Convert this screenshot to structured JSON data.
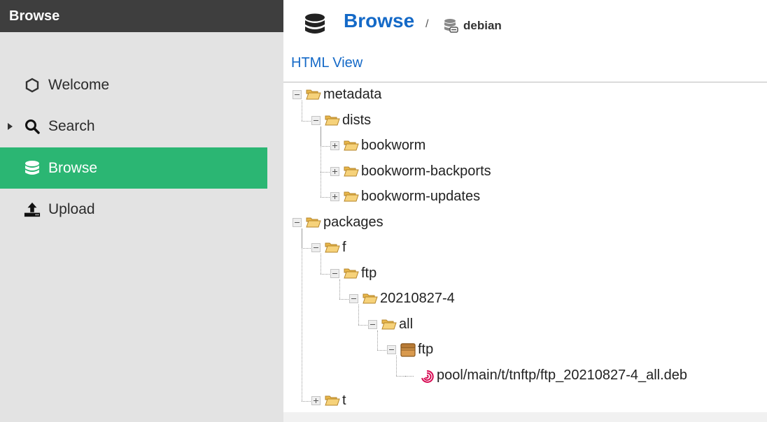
{
  "sidebar": {
    "title": "Browse",
    "items": [
      {
        "label": "Welcome",
        "icon": "hexagon-icon"
      },
      {
        "label": "Search",
        "icon": "search-icon"
      },
      {
        "label": "Browse",
        "icon": "database-icon",
        "active": true
      },
      {
        "label": "Upload",
        "icon": "upload-icon"
      }
    ]
  },
  "header": {
    "title": "Browse",
    "separator": "/",
    "repository": "debian"
  },
  "html_view_link": "HTML View",
  "tree": [
    {
      "label": "metadata",
      "icon": "folder-open-icon",
      "state": "expanded",
      "depth": 0
    },
    {
      "label": "dists",
      "icon": "folder-open-icon",
      "state": "expanded",
      "depth": 1
    },
    {
      "label": "bookworm",
      "icon": "folder-open-icon",
      "state": "collapsed",
      "depth": 2
    },
    {
      "label": "bookworm-backports",
      "icon": "folder-open-icon",
      "state": "collapsed",
      "depth": 2
    },
    {
      "label": "bookworm-updates",
      "icon": "folder-open-icon",
      "state": "collapsed",
      "depth": 2
    },
    {
      "label": "packages",
      "icon": "folder-open-icon",
      "state": "expanded",
      "depth": 0
    },
    {
      "label": "f",
      "icon": "folder-open-icon",
      "state": "expanded",
      "depth": 1
    },
    {
      "label": "ftp",
      "icon": "folder-open-icon",
      "state": "expanded",
      "depth": 2
    },
    {
      "label": "20210827-4",
      "icon": "folder-open-icon",
      "state": "expanded",
      "depth": 3
    },
    {
      "label": "all",
      "icon": "folder-open-icon",
      "state": "expanded",
      "depth": 4
    },
    {
      "label": "ftp",
      "icon": "package-box-icon",
      "state": "expanded",
      "depth": 5
    },
    {
      "label": "pool/main/t/tnftp/ftp_20210827-4_all.deb",
      "icon": "debian-swirl-icon",
      "state": "leaf",
      "depth": 6
    },
    {
      "label": "t",
      "icon": "folder-open-icon",
      "state": "collapsed",
      "depth": 1
    }
  ],
  "colors": {
    "accent": "#1469c7",
    "active_nav": "#2bb673",
    "sidebar_bg": "#e3e3e3",
    "sidebar_header": "#3e3e3e",
    "folder": "#f3c667",
    "debian": "#d70a53"
  }
}
